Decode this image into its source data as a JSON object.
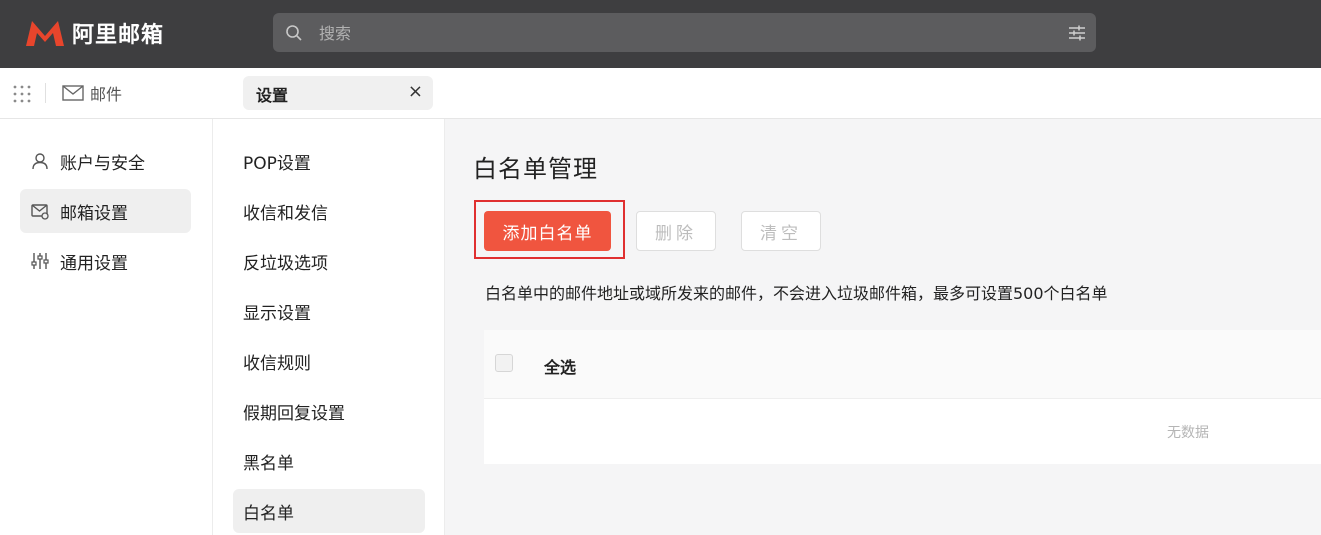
{
  "app": {
    "title": "阿里邮箱",
    "brand_color": "#e8452c"
  },
  "search": {
    "placeholder": "搜索",
    "icon": "search-icon",
    "filter_icon": "filter-sliders-icon"
  },
  "tabbar": {
    "apps_icon": "grid-dots-icon",
    "mail_label": "邮件",
    "settings_tab": {
      "label": "设置",
      "close": "×"
    }
  },
  "left_nav": {
    "items": [
      {
        "label": "账户与安全",
        "icon": "user-icon",
        "active": false
      },
      {
        "label": "邮箱设置",
        "icon": "mailbox-settings-icon",
        "active": true
      },
      {
        "label": "通用设置",
        "icon": "sliders-icon",
        "active": false
      }
    ]
  },
  "sub_nav": {
    "items": [
      {
        "label": "POP设置"
      },
      {
        "label": "收信和发信"
      },
      {
        "label": "反垃圾选项"
      },
      {
        "label": "显示设置"
      },
      {
        "label": "收信规则"
      },
      {
        "label": "假期回复设置"
      },
      {
        "label": "黑名单"
      },
      {
        "label": "白名单",
        "active": true
      }
    ]
  },
  "main": {
    "title": "白名单管理",
    "buttons": {
      "add": "添加白名单",
      "delete": "删除",
      "clear": "清空"
    },
    "description": "白名单中的邮件地址或域所发来的邮件，不会进入垃圾邮件箱，最多可设置500个白名单",
    "table": {
      "select_all": "全选",
      "empty": "无数据"
    }
  },
  "colors": {
    "header_bg": "#3e3e40",
    "primary_button": "#f0553f",
    "highlight_border": "#e03030"
  }
}
